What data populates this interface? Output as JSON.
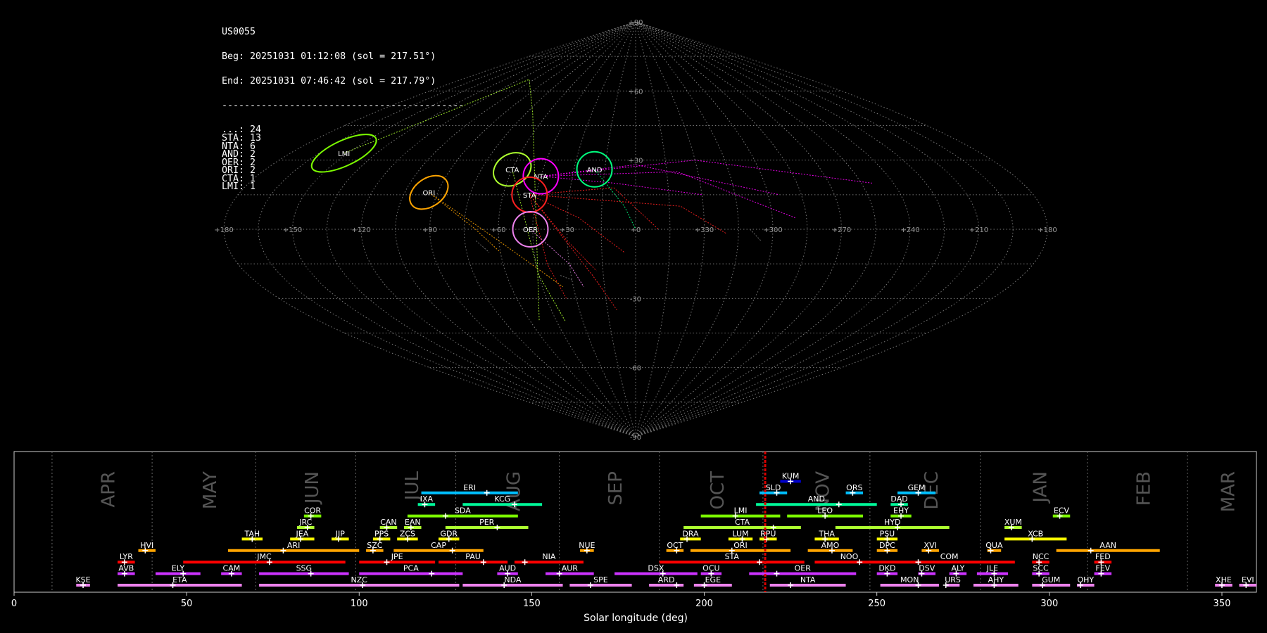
{
  "header": {
    "id": "US0055",
    "begin": "Beg: 20251031 01:12:08 (sol = 217.51°)",
    "end": "End: 20251031 07:46:42 (sol = 217.79°)",
    "separator": "-------------------------------------------",
    "counts": [
      {
        "code": "...",
        "n": 24
      },
      {
        "code": "STA",
        "n": 13
      },
      {
        "code": "NTA",
        "n": 6
      },
      {
        "code": "AND",
        "n": 2
      },
      {
        "code": "OER",
        "n": 2
      },
      {
        "code": "ORI",
        "n": 2
      },
      {
        "code": "CTA",
        "n": 1
      },
      {
        "code": "LMI",
        "n": 1
      }
    ]
  },
  "sky_map": {
    "projection": "sinusoidal",
    "lon_ticks": [
      "+180",
      "+150",
      "+120",
      "+90",
      "+60",
      "+30",
      "+0",
      "+330",
      "+300",
      "+270",
      "+240",
      "+210",
      "+180"
    ],
    "lat_ticks": [
      "+90",
      "+60",
      "+30",
      "-30",
      "-60",
      "-90"
    ],
    "radiants": [
      {
        "code": "LMI",
        "color": "#7cfc00",
        "lon": 152,
        "lat": 33
      },
      {
        "code": "ORI",
        "color": "#ffa500",
        "lon": 94,
        "lat": 16
      },
      {
        "code": "CTA",
        "color": "#adff2f",
        "lon": 60,
        "lat": 26
      },
      {
        "code": "NTA",
        "color": "#ff00ff",
        "lon": 45,
        "lat": 23
      },
      {
        "code": "STA",
        "color": "#ff2020",
        "lon": 48,
        "lat": 15
      },
      {
        "code": "AND",
        "color": "#00ff7f",
        "lon": 20,
        "lat": 26
      },
      {
        "code": "OER",
        "color": "#ee82ee",
        "lon": 46,
        "lat": 0
      }
    ]
  },
  "chart_data": {
    "type": "timeline",
    "xlabel": "Solar longitude (deg)",
    "xlim": [
      0,
      360
    ],
    "xticks": [
      0,
      50,
      100,
      150,
      200,
      250,
      300,
      350
    ],
    "current_sol": [
      217.51,
      217.79
    ],
    "months": [
      {
        "name": "APR",
        "start": 11,
        "end": 40
      },
      {
        "name": "MAY",
        "start": 40,
        "end": 70
      },
      {
        "name": "JUN",
        "start": 70,
        "end": 99
      },
      {
        "name": "JUL",
        "start": 99,
        "end": 128
      },
      {
        "name": "AUG",
        "start": 128,
        "end": 158
      },
      {
        "name": "SEP",
        "start": 158,
        "end": 187
      },
      {
        "name": "OCT",
        "start": 187,
        "end": 217
      },
      {
        "name": "NOV",
        "start": 217,
        "end": 248
      },
      {
        "name": "DEC",
        "start": 248,
        "end": 280
      },
      {
        "name": "JAN",
        "start": 280,
        "end": 311
      },
      {
        "name": "FEB",
        "start": 311,
        "end": 340
      },
      {
        "name": "MAR",
        "start": 340,
        "end": 371
      }
    ],
    "showers": [
      {
        "code": "KUM",
        "start": 222,
        "end": 228,
        "peak": 225,
        "row": 9,
        "color": "#0000cd"
      },
      {
        "code": "ERI",
        "start": 118,
        "end": 146,
        "peak": 137,
        "row": 8,
        "color": "#00bfff"
      },
      {
        "code": "SLD",
        "start": 216,
        "end": 224,
        "peak": 221,
        "row": 8,
        "color": "#00bfff"
      },
      {
        "code": "ORS",
        "start": 241,
        "end": 246,
        "peak": 243,
        "row": 8,
        "color": "#00bfff"
      },
      {
        "code": "GEM",
        "start": 256,
        "end": 267,
        "peak": 262,
        "row": 8,
        "color": "#00bfff"
      },
      {
        "code": "IXA",
        "start": 117,
        "end": 122,
        "peak": 119,
        "row": 7,
        "color": "#00fa9a"
      },
      {
        "code": "KCG",
        "start": 130,
        "end": 153,
        "peak": 145,
        "row": 7,
        "color": "#00fa9a"
      },
      {
        "code": "AND",
        "start": 215,
        "end": 250,
        "peak": 239,
        "row": 7,
        "color": "#00fa9a"
      },
      {
        "code": "DAD",
        "start": 254,
        "end": 259,
        "peak": 257,
        "row": 7,
        "color": "#00fa9a"
      },
      {
        "code": "COR",
        "start": 84,
        "end": 89,
        "peak": 86,
        "row": 6,
        "color": "#7cfc00"
      },
      {
        "code": "SDA",
        "start": 114,
        "end": 146,
        "peak": 125,
        "row": 6,
        "color": "#7cfc00"
      },
      {
        "code": "LMI",
        "start": 199,
        "end": 222,
        "peak": 209,
        "row": 6,
        "color": "#7cfc00"
      },
      {
        "code": "LEO",
        "start": 224,
        "end": 246,
        "peak": 235,
        "row": 6,
        "color": "#7cfc00"
      },
      {
        "code": "EHY",
        "start": 254,
        "end": 260,
        "peak": 257,
        "row": 6,
        "color": "#7cfc00"
      },
      {
        "code": "ECV",
        "start": 301,
        "end": 306,
        "peak": 303,
        "row": 6,
        "color": "#7cfc00"
      },
      {
        "code": "JRC",
        "start": 82,
        "end": 87,
        "peak": 85,
        "row": 5,
        "color": "#adff2f"
      },
      {
        "code": "CAN",
        "start": 106,
        "end": 111,
        "peak": 108,
        "row": 5,
        "color": "#adff2f"
      },
      {
        "code": "EAN",
        "start": 113,
        "end": 118,
        "peak": 115,
        "row": 5,
        "color": "#adff2f"
      },
      {
        "code": "PER",
        "start": 125,
        "end": 149,
        "peak": 140,
        "row": 5,
        "color": "#adff2f"
      },
      {
        "code": "CTA",
        "start": 194,
        "end": 228,
        "peak": 220,
        "row": 5,
        "color": "#adff2f"
      },
      {
        "code": "HYD",
        "start": 238,
        "end": 271,
        "peak": 256,
        "row": 5,
        "color": "#adff2f"
      },
      {
        "code": "XUM",
        "start": 287,
        "end": 292,
        "peak": 289,
        "row": 5,
        "color": "#adff2f"
      },
      {
        "code": "TAH",
        "start": 66,
        "end": 72,
        "peak": 69,
        "row": 4,
        "color": "#ffff00"
      },
      {
        "code": "JEA",
        "start": 80,
        "end": 87,
        "peak": 83,
        "row": 4,
        "color": "#ffff00"
      },
      {
        "code": "JIP",
        "start": 92,
        "end": 97,
        "peak": 94,
        "row": 4,
        "color": "#ffff00"
      },
      {
        "code": "PPS",
        "start": 104,
        "end": 109,
        "peak": 106,
        "row": 4,
        "color": "#ffff00"
      },
      {
        "code": "ZCS",
        "start": 111,
        "end": 117,
        "peak": 114,
        "row": 4,
        "color": "#ffff00"
      },
      {
        "code": "GDR",
        "start": 123,
        "end": 129,
        "peak": 126,
        "row": 4,
        "color": "#ffff00"
      },
      {
        "code": "DRA",
        "start": 193,
        "end": 199,
        "peak": 195,
        "row": 4,
        "color": "#ffff00"
      },
      {
        "code": "LUM",
        "start": 207,
        "end": 214,
        "peak": 211,
        "row": 4,
        "color": "#ffff00"
      },
      {
        "code": "RPU",
        "start": 216,
        "end": 221,
        "peak": 218,
        "row": 4,
        "color": "#ffff00"
      },
      {
        "code": "THA",
        "start": 232,
        "end": 239,
        "peak": 235,
        "row": 4,
        "color": "#ffff00"
      },
      {
        "code": "PSU",
        "start": 250,
        "end": 256,
        "peak": 253,
        "row": 4,
        "color": "#ffff00"
      },
      {
        "code": "XCB",
        "start": 287,
        "end": 305,
        "peak": 295,
        "row": 4,
        "color": "#ffff00"
      },
      {
        "code": "HVI",
        "start": 36,
        "end": 41,
        "peak": 38,
        "row": 3,
        "color": "#ffa500"
      },
      {
        "code": "ARI",
        "start": 62,
        "end": 100,
        "peak": 78,
        "row": 3,
        "color": "#ffa500"
      },
      {
        "code": "SZC",
        "start": 102,
        "end": 107,
        "peak": 104,
        "row": 3,
        "color": "#ffa500"
      },
      {
        "code": "CAP",
        "start": 110,
        "end": 136,
        "peak": 127,
        "row": 3,
        "color": "#ffa500"
      },
      {
        "code": "NUE",
        "start": 164,
        "end": 168,
        "peak": 166,
        "row": 3,
        "color": "#ffa500"
      },
      {
        "code": "OCT",
        "start": 189,
        "end": 194,
        "peak": 192,
        "row": 3,
        "color": "#ffa500"
      },
      {
        "code": "ORI",
        "start": 196,
        "end": 225,
        "peak": 208,
        "row": 3,
        "color": "#ffa500"
      },
      {
        "code": "AMO",
        "start": 230,
        "end": 243,
        "peak": 237,
        "row": 3,
        "color": "#ffa500"
      },
      {
        "code": "DPC",
        "start": 250,
        "end": 256,
        "peak": 253,
        "row": 3,
        "color": "#ffa500"
      },
      {
        "code": "XVI",
        "start": 263,
        "end": 268,
        "peak": 265,
        "row": 3,
        "color": "#ffa500"
      },
      {
        "code": "QUA",
        "start": 282,
        "end": 286,
        "peak": 283,
        "row": 3,
        "color": "#ffa500"
      },
      {
        "code": "AAN",
        "start": 302,
        "end": 332,
        "peak": 312,
        "row": 3,
        "color": "#ffa500"
      },
      {
        "code": "LYR",
        "start": 30,
        "end": 35,
        "peak": 32,
        "row": 2,
        "color": "#ff0000"
      },
      {
        "code": "JMC",
        "start": 49,
        "end": 96,
        "peak": 74,
        "row": 2,
        "color": "#ff0000"
      },
      {
        "code": "JPE",
        "start": 100,
        "end": 122,
        "peak": 108,
        "row": 2,
        "color": "#ff0000"
      },
      {
        "code": "PAU",
        "start": 123,
        "end": 143,
        "peak": 136,
        "row": 2,
        "color": "#ff0000"
      },
      {
        "code": "NIA",
        "start": 145,
        "end": 165,
        "peak": 148,
        "row": 2,
        "color": "#ff0000"
      },
      {
        "code": "STA",
        "start": 187,
        "end": 229,
        "peak": 216,
        "row": 2,
        "color": "#ff0000"
      },
      {
        "code": "NOO",
        "start": 232,
        "end": 252,
        "peak": 245,
        "row": 2,
        "color": "#ff0000"
      },
      {
        "code": "COM",
        "start": 252,
        "end": 290,
        "peak": 262,
        "row": 2,
        "color": "#ff0000"
      },
      {
        "code": "NCC",
        "start": 295,
        "end": 300,
        "peak": 297,
        "row": 2,
        "color": "#ff0000"
      },
      {
        "code": "FED",
        "start": 313,
        "end": 318,
        "peak": 315,
        "row": 2,
        "color": "#ff0000"
      },
      {
        "code": "AVB",
        "start": 30,
        "end": 35,
        "peak": 32,
        "row": 1,
        "color": "#cc33ff"
      },
      {
        "code": "ELY",
        "start": 41,
        "end": 54,
        "peak": 49,
        "row": 1,
        "color": "#cc33ff"
      },
      {
        "code": "CAM",
        "start": 60,
        "end": 66,
        "peak": 63,
        "row": 1,
        "color": "#cc33ff"
      },
      {
        "code": "SSG",
        "start": 71,
        "end": 97,
        "peak": 86,
        "row": 1,
        "color": "#cc33ff"
      },
      {
        "code": "PCA",
        "start": 100,
        "end": 130,
        "peak": 121,
        "row": 1,
        "color": "#cc33ff"
      },
      {
        "code": "AUD",
        "start": 140,
        "end": 146,
        "peak": 143,
        "row": 1,
        "color": "#cc33ff"
      },
      {
        "code": "AUR",
        "start": 154,
        "end": 168,
        "peak": 158,
        "row": 1,
        "color": "#cc33ff"
      },
      {
        "code": "DSX",
        "start": 174,
        "end": 198,
        "peak": 188,
        "row": 1,
        "color": "#cc33ff"
      },
      {
        "code": "OCU",
        "start": 199,
        "end": 205,
        "peak": 202,
        "row": 1,
        "color": "#cc33ff"
      },
      {
        "code": "OER",
        "start": 213,
        "end": 244,
        "peak": 221,
        "row": 1,
        "color": "#cc33ff"
      },
      {
        "code": "DKD",
        "start": 250,
        "end": 256,
        "peak": 253,
        "row": 1,
        "color": "#cc33ff"
      },
      {
        "code": "DSV",
        "start": 267,
        "end": 262,
        "peak": 263,
        "row": 1,
        "color": "#cc33ff"
      },
      {
        "code": "ALY",
        "start": 271,
        "end": 276,
        "peak": 273,
        "row": 1,
        "color": "#cc33ff"
      },
      {
        "code": "JLE",
        "start": 279,
        "end": 288,
        "peak": 284,
        "row": 1,
        "color": "#cc33ff"
      },
      {
        "code": "SCC",
        "start": 295,
        "end": 300,
        "peak": 297,
        "row": 1,
        "color": "#cc33ff"
      },
      {
        "code": "FEV",
        "start": 313,
        "end": 318,
        "peak": 315,
        "row": 1,
        "color": "#cc33ff"
      },
      {
        "code": "KSE",
        "start": 18,
        "end": 22,
        "peak": 20,
        "row": 0,
        "color": "#ee82ee"
      },
      {
        "code": "ETA",
        "start": 30,
        "end": 66,
        "peak": 46,
        "row": 0,
        "color": "#ee82ee"
      },
      {
        "code": "NZC",
        "start": 71,
        "end": 129,
        "peak": 101,
        "row": 0,
        "color": "#ee82ee"
      },
      {
        "code": "NDA",
        "start": 130,
        "end": 159,
        "peak": 142,
        "row": 0,
        "color": "#ee82ee"
      },
      {
        "code": "SPE",
        "start": 161,
        "end": 179,
        "peak": 167,
        "row": 0,
        "color": "#ee82ee"
      },
      {
        "code": "ARD",
        "start": 184,
        "end": 194,
        "peak": 192,
        "row": 0,
        "color": "#ee82ee"
      },
      {
        "code": "EGE",
        "start": 197,
        "end": 208,
        "peak": 200,
        "row": 0,
        "color": "#ee82ee"
      },
      {
        "code": "NTA",
        "start": 219,
        "end": 241,
        "peak": 225,
        "row": 0,
        "color": "#ee82ee"
      },
      {
        "code": "MON",
        "start": 251,
        "end": 268,
        "peak": 262,
        "row": 0,
        "color": "#ee82ee"
      },
      {
        "code": "URS",
        "start": 270,
        "end": 274,
        "peak": 270,
        "row": 0,
        "color": "#ee82ee"
      },
      {
        "code": "AHY",
        "start": 278,
        "end": 291,
        "peak": 284,
        "row": 0,
        "color": "#ee82ee"
      },
      {
        "code": "GUM",
        "start": 295,
        "end": 306,
        "peak": 298,
        "row": 0,
        "color": "#ee82ee"
      },
      {
        "code": "OHY",
        "start": 308,
        "end": 313,
        "peak": 309,
        "row": 0,
        "color": "#ee82ee"
      },
      {
        "code": "XHE",
        "start": 348,
        "end": 353,
        "peak": 350,
        "row": 0,
        "color": "#ee82ee"
      },
      {
        "code": "EVI",
        "start": 355,
        "end": 360,
        "peak": 357,
        "row": 0,
        "color": "#ee82ee"
      }
    ]
  }
}
